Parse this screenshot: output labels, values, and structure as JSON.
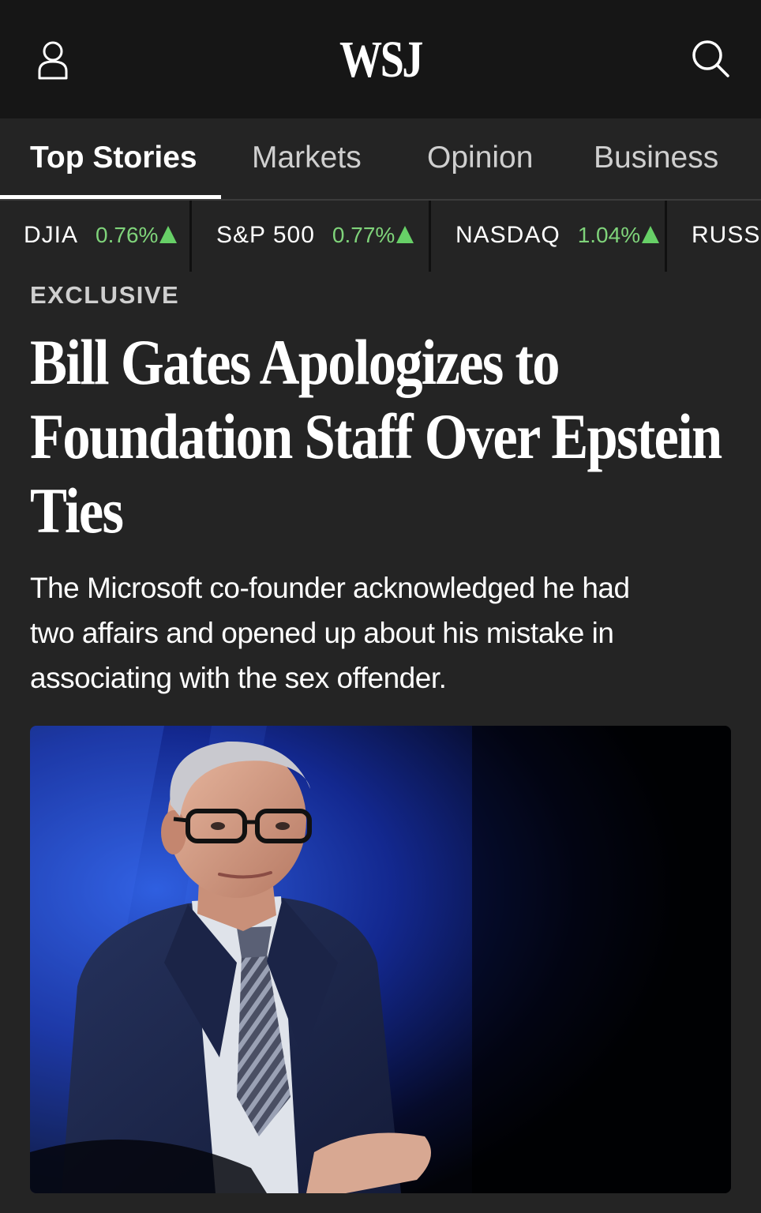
{
  "header": {
    "logo": "WSJ",
    "user_icon": "user-icon",
    "search_icon": "search-icon"
  },
  "nav": {
    "tabs": [
      {
        "label": "Top Stories",
        "active": true
      },
      {
        "label": "Markets",
        "active": false
      },
      {
        "label": "Opinion",
        "active": false
      },
      {
        "label": "Business",
        "active": false
      }
    ]
  },
  "ticker": {
    "items": [
      {
        "name": "DJIA",
        "change": "0.76%",
        "direction": "up"
      },
      {
        "name": "S&P 500",
        "change": "0.77%",
        "direction": "up"
      },
      {
        "name": "NASDAQ",
        "change": "1.04%",
        "direction": "up"
      },
      {
        "name": "RUSSE",
        "change": "",
        "direction": ""
      }
    ],
    "up_color": "#67d067"
  },
  "article": {
    "kicker": "EXCLUSIVE",
    "headline_lines": [
      "Bill Gates Apologizes to",
      "Foundation Staff Over Epstein",
      "Ties"
    ],
    "dek_lines": [
      "The Microsoft co-founder acknowledged he had",
      "two affairs and opened up about his mistake in",
      "associating with the sex offender."
    ]
  },
  "colors": {
    "background": "#242424",
    "header_bg": "#161616",
    "accent_green": "#7fd37a"
  }
}
